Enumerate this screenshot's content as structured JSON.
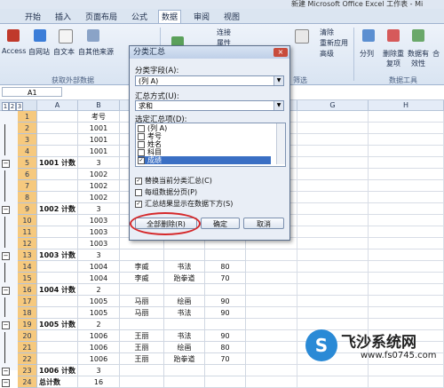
{
  "window": {
    "title": "新建 Microsoft Office Excel 工作表 - Mi"
  },
  "tabs": [
    "开始",
    "插入",
    "页面布局",
    "公式",
    "数据",
    "审阅",
    "视图"
  ],
  "active_tab": "数据",
  "ribbon": {
    "get_external": [
      "Access",
      "自网站",
      "自文本",
      "自其他来源",
      "现有连接"
    ],
    "get_external_group": "获取外部数据",
    "refresh_label": "全部刷新",
    "connections": [
      "连接",
      "属性",
      "编辑链接"
    ],
    "filter_label": "筛选",
    "advanced": [
      "清除",
      "重新应用",
      "高级"
    ],
    "sort_filter_group": "筛选",
    "tools": [
      "分列",
      "删除重复项",
      "数据有效性"
    ],
    "tools_group": "数据工具",
    "outline": [
      "合"
    ]
  },
  "formula_bar": {
    "cell_ref": "A1"
  },
  "sheet": {
    "columns": [
      "A",
      "B",
      "C",
      "D",
      "E",
      "F",
      "G",
      "H"
    ],
    "outline_levels": [
      "1",
      "2",
      "3"
    ],
    "rows": [
      {
        "n": "1",
        "a": "",
        "b": "考号",
        "c": "",
        "d": "",
        "e": "",
        "sel": true
      },
      {
        "n": "2",
        "a": "",
        "b": "1001",
        "c": "",
        "d": "",
        "e": "",
        "sel": true
      },
      {
        "n": "3",
        "a": "",
        "b": "1001",
        "c": "",
        "d": "",
        "e": "",
        "sel": true
      },
      {
        "n": "4",
        "a": "",
        "b": "1001",
        "c": "",
        "d": "",
        "e": "",
        "sel": true
      },
      {
        "n": "5",
        "a": "1001 计数",
        "b": "3",
        "c": "",
        "d": "",
        "e": "",
        "sel": true
      },
      {
        "n": "6",
        "a": "",
        "b": "1002",
        "c": "",
        "d": "",
        "e": "",
        "sel": true
      },
      {
        "n": "7",
        "a": "",
        "b": "1002",
        "c": "",
        "d": "",
        "e": "",
        "sel": true
      },
      {
        "n": "8",
        "a": "",
        "b": "1002",
        "c": "",
        "d": "",
        "e": "",
        "sel": true
      },
      {
        "n": "9",
        "a": "1002 计数",
        "b": "3",
        "c": "",
        "d": "",
        "e": "",
        "sel": true
      },
      {
        "n": "10",
        "a": "",
        "b": "1003",
        "c": "",
        "d": "",
        "e": "",
        "sel": true
      },
      {
        "n": "11",
        "a": "",
        "b": "1003",
        "c": "",
        "d": "",
        "e": "",
        "sel": true
      },
      {
        "n": "12",
        "a": "",
        "b": "1003",
        "c": "",
        "d": "",
        "e": "",
        "sel": true
      },
      {
        "n": "13",
        "a": "1003 计数",
        "b": "3",
        "c": "",
        "d": "",
        "e": "",
        "sel": true
      },
      {
        "n": "14",
        "a": "",
        "b": "1004",
        "c": "李威",
        "d": "书法",
        "e": "80",
        "sel": true
      },
      {
        "n": "15",
        "a": "",
        "b": "1004",
        "c": "李威",
        "d": "跆拳道",
        "e": "70",
        "sel": true
      },
      {
        "n": "16",
        "a": "1004 计数",
        "b": "2",
        "c": "",
        "d": "",
        "e": "",
        "sel": true
      },
      {
        "n": "17",
        "a": "",
        "b": "1005",
        "c": "马丽",
        "d": "绘画",
        "e": "90",
        "sel": true
      },
      {
        "n": "18",
        "a": "",
        "b": "1005",
        "c": "马丽",
        "d": "书法",
        "e": "90",
        "sel": true
      },
      {
        "n": "19",
        "a": "1005 计数",
        "b": "2",
        "c": "",
        "d": "",
        "e": "",
        "sel": true
      },
      {
        "n": "20",
        "a": "",
        "b": "1006",
        "c": "王丽",
        "d": "书法",
        "e": "90",
        "sel": true
      },
      {
        "n": "21",
        "a": "",
        "b": "1006",
        "c": "王丽",
        "d": "绘画",
        "e": "80",
        "sel": true
      },
      {
        "n": "22",
        "a": "",
        "b": "1006",
        "c": "王丽",
        "d": "跆拳道",
        "e": "70",
        "sel": true
      },
      {
        "n": "23",
        "a": "1006 计数",
        "b": "3",
        "c": "",
        "d": "",
        "e": "",
        "sel": true
      },
      {
        "n": "24",
        "a": "总计数",
        "b": "16",
        "c": "",
        "d": "",
        "e": "",
        "sel": true
      }
    ]
  },
  "dialog": {
    "title": "分类汇总",
    "close": "×",
    "group_field_label": "分类字段(A):",
    "group_field_value": "(列 A)",
    "method_label": "汇总方式(U):",
    "method_value": "求和",
    "items_label": "选定汇总项(D):",
    "items": [
      {
        "label": "(列 A)",
        "checked": false,
        "selected": false
      },
      {
        "label": "考号",
        "checked": false,
        "selected": false
      },
      {
        "label": "姓名",
        "checked": false,
        "selected": false
      },
      {
        "label": "科目",
        "checked": false,
        "selected": false
      },
      {
        "label": "成绩",
        "checked": true,
        "selected": true
      }
    ],
    "options": [
      {
        "label": "替换当前分类汇总(C)",
        "checked": true
      },
      {
        "label": "每组数据分页(P)",
        "checked": false
      },
      {
        "label": "汇总结果显示在数据下方(S)",
        "checked": true
      }
    ],
    "buttons": {
      "remove_all": "全部删除(R)",
      "ok": "确定",
      "cancel": "取消"
    },
    "check_mark": "✓"
  },
  "watermark": {
    "name": "飞沙系统网",
    "url": "www.fs0745.com",
    "logo": "S"
  }
}
